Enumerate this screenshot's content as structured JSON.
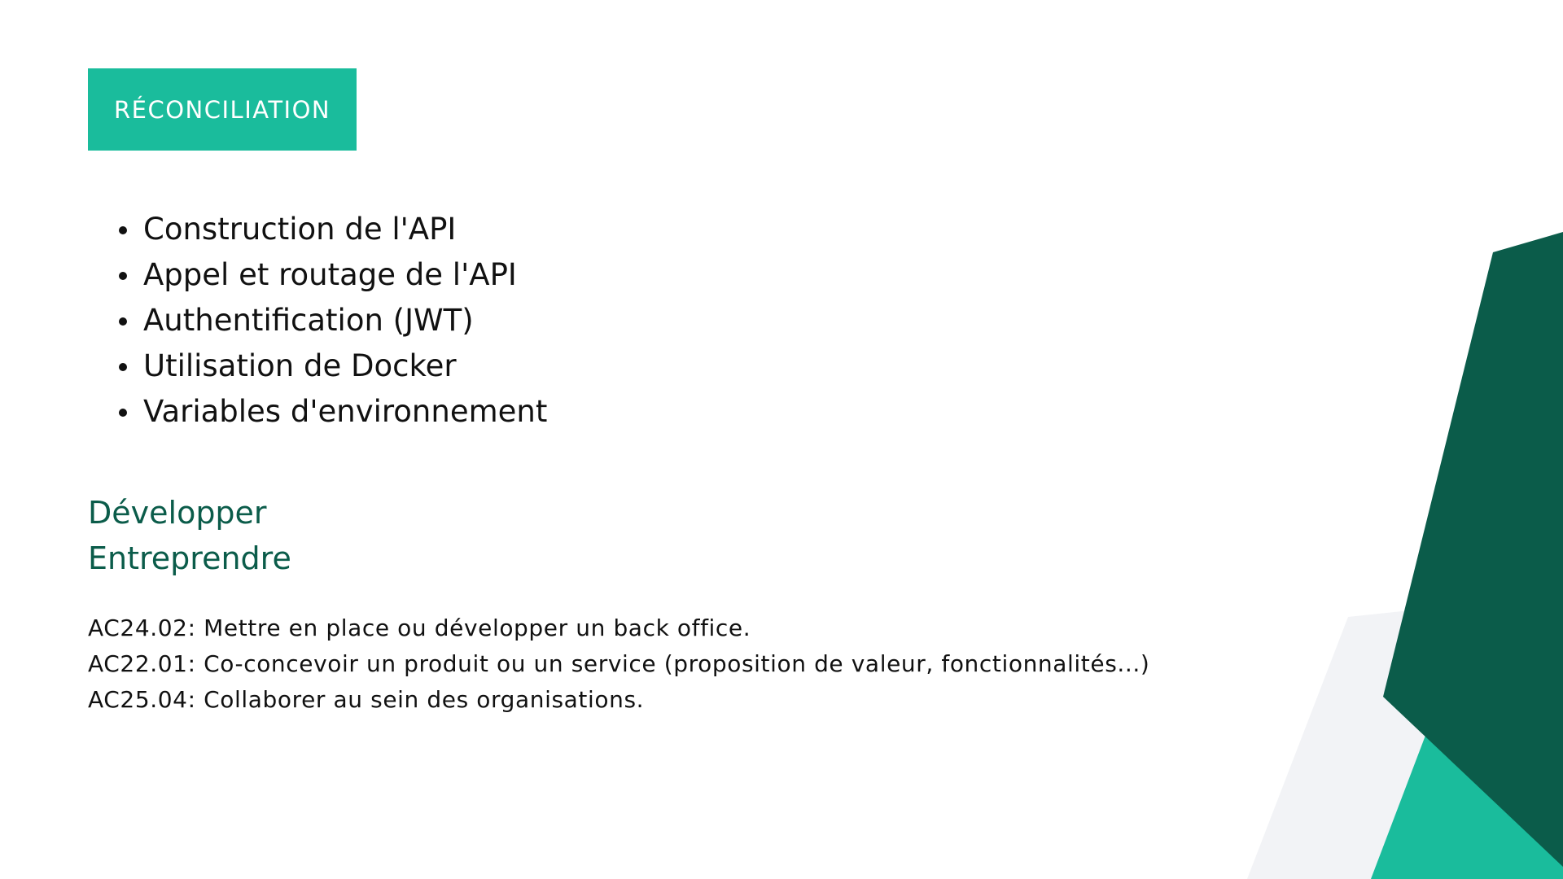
{
  "colors": {
    "teal_accent": "#1abc9c",
    "dark_green": "#0b5c4a",
    "light_gray_shape": "#f2f3f6",
    "text": "#111111"
  },
  "tag": {
    "label": "RÉCONCILIATION"
  },
  "bullets": [
    "Construction de l'API",
    "Appel et routage de l'API",
    "Authentification (JWT)",
    "Utilisation de Docker",
    "Variables d'environnement"
  ],
  "skills": [
    "Développer",
    "Entreprendre"
  ],
  "learning_outcomes": [
    "AC24.02: Mettre en place ou développer un back office.",
    "AC22.01: Co-concevoir un produit ou un service (proposition de valeur, fonctionnalités...)",
    "AC25.04: Collaborer au sein des organisations."
  ]
}
